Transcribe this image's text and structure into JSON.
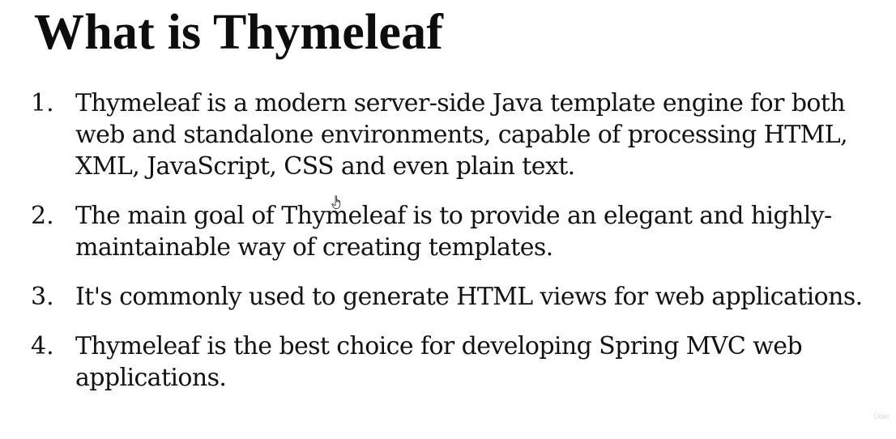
{
  "slide": {
    "title": "What is Thymeleaf",
    "items": [
      {
        "number": "1.",
        "text": "Thymeleaf is a modern server-side Java template engine for both web and standalone environments, capable of processing HTML, XML, JavaScript, CSS and even plain text."
      },
      {
        "number": "2.",
        "text": "The main goal of Thymeleaf is to provide an elegant and highly-maintainable way of creating templates."
      },
      {
        "number": "3.",
        "text": "It's commonly used to generate HTML views for web applications."
      },
      {
        "number": "4.",
        "text": "Thymeleaf is the best choice for developing Spring MVC web applications."
      }
    ]
  },
  "overlay": {
    "cursor_icon": "hand-pointer-icon",
    "watermark": "Ùder"
  }
}
